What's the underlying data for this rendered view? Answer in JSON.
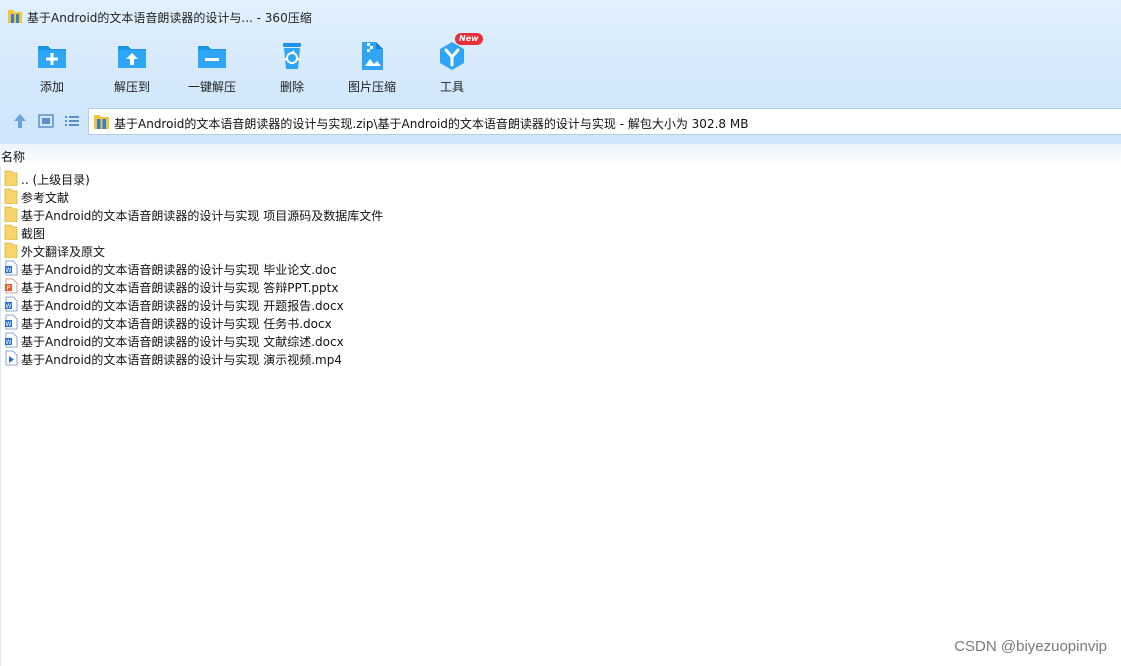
{
  "window": {
    "title": "基于Android的文本语音朗读器的设计与... - 360压缩"
  },
  "toolbar": {
    "buttons": [
      {
        "label": "添加",
        "icon": "add-icon"
      },
      {
        "label": "解压到",
        "icon": "extract-to-icon"
      },
      {
        "label": "一键解压",
        "icon": "one-click-extract-icon"
      },
      {
        "label": "删除",
        "icon": "delete-icon"
      },
      {
        "label": "图片压缩",
        "icon": "image-compress-icon"
      },
      {
        "label": "工具",
        "icon": "tools-icon",
        "badge": "New"
      }
    ]
  },
  "address": {
    "path": "基于Android的文本语音朗读器的设计与实现.zip\\基于Android的文本语音朗读器的设计与实现 - 解包大小为 302.8 MB"
  },
  "list": {
    "column_name": "名称",
    "rows": [
      {
        "name": ".. (上级目录)",
        "type": "folder"
      },
      {
        "name": "参考文献",
        "type": "folder"
      },
      {
        "name": "基于Android的文本语音朗读器的设计与实现 项目源码及数据库文件",
        "type": "folder"
      },
      {
        "name": "截图",
        "type": "folder"
      },
      {
        "name": "外文翻译及原文",
        "type": "folder"
      },
      {
        "name": "基于Android的文本语音朗读器的设计与实现 毕业论文.doc",
        "type": "word"
      },
      {
        "name": "基于Android的文本语音朗读器的设计与实现 答辩PPT.pptx",
        "type": "ppt"
      },
      {
        "name": "基于Android的文本语音朗读器的设计与实现 开题报告.docx",
        "type": "word"
      },
      {
        "name": "基于Android的文本语音朗读器的设计与实现 任务书.docx",
        "type": "word"
      },
      {
        "name": "基于Android的文本语音朗读器的设计与实现 文献综述.docx",
        "type": "word"
      },
      {
        "name": "基于Android的文本语音朗读器的设计与实现 演示视频.mp4",
        "type": "video"
      }
    ]
  },
  "watermark": "CSDN @biyezuopinvip",
  "colors": {
    "accent": "#1d9bf0",
    "folder": "#f7d56b",
    "word": "#2b6fd3",
    "ppt": "#e0622a",
    "badge": "#e8303a"
  }
}
